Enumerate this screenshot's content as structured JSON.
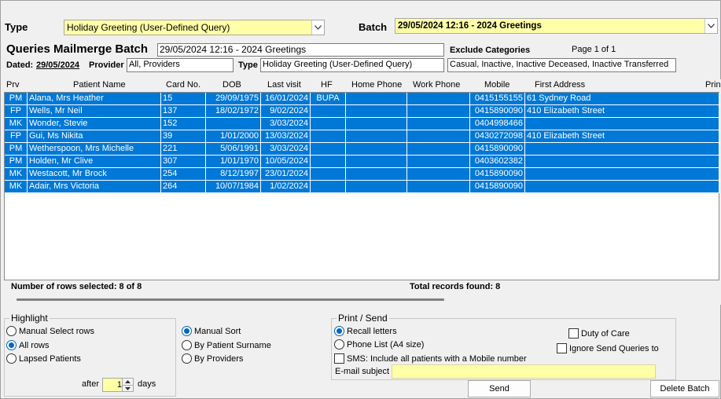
{
  "top": {
    "type_label": "Type",
    "type_value": "Holiday Greeting (User-Defined Query)",
    "batch_label": "Batch",
    "batch_value": "29/05/2024 12:16 - 2024 Greetings"
  },
  "header": {
    "title": "Queries Mailmerge Batch",
    "batch_name": "29/05/2024 12:16 - 2024 Greetings",
    "exclude_label": "Exclude Categories",
    "page_info": "Page 1 of 1",
    "dated_label": "Dated:",
    "dated_value": "29/05/2024",
    "provider_label": "Provider",
    "provider_value": "All,   Providers",
    "type_label": "Type",
    "type_value": "Holiday Greeting (User-Defined Query)",
    "exclude_value": "Casual, Inactive, Inactive Deceased, Inactive Transferred"
  },
  "grid": {
    "columns": [
      "Prv",
      "Patient Name",
      "Card No.",
      "DOB",
      "Last visit",
      "HF",
      "Home Phone",
      "Work Phone",
      "Mobile",
      "First Address",
      "Prin"
    ],
    "rows": [
      [
        "PM",
        "Alana, Mrs Heather",
        "15",
        "29/09/1975",
        "16/01/2024",
        "BUPA",
        "",
        "",
        "0415155155",
        "61 Sydney Road"
      ],
      [
        "FP",
        "Wells, Mr Neil",
        "137",
        "18/02/1972",
        "9/02/2024",
        "",
        "",
        "",
        "0415890090",
        "410 Elizabeth Street"
      ],
      [
        "MK",
        "Wonder,  Stevie",
        "152",
        "",
        "3/03/2024",
        "",
        "",
        "",
        "0404998466",
        ""
      ],
      [
        "FP",
        "Gui, Ms Nikita",
        "39",
        "1/01/2000",
        "13/03/2024",
        "",
        "",
        "",
        "0430272098",
        "410 Elizabeth Street"
      ],
      [
        "PM",
        "Wetherspoon, Mrs Michelle",
        "221",
        "5/06/1991",
        "3/03/2024",
        "",
        "",
        "",
        "0415890090",
        ""
      ],
      [
        "PM",
        "Holden, Mr Clive",
        "307",
        "1/01/1970",
        "10/05/2024",
        "",
        "",
        "",
        "0403602382",
        ""
      ],
      [
        "MK",
        "Westacott, Mr Brock",
        "254",
        "8/12/1997",
        "23/01/2024",
        "",
        "",
        "",
        "0415890090",
        ""
      ],
      [
        "MK",
        "Adair, Mrs Victoria",
        "264",
        "10/07/1984",
        "1/02/2024",
        "",
        "",
        "",
        "0415890090",
        ""
      ]
    ],
    "rows_selected": "Number of rows selected: 8 of 8",
    "total_records": "Total records found: 8"
  },
  "highlight": {
    "title": "Highlight",
    "options": [
      "Manual Select rows",
      "All rows",
      "Lapsed Patients"
    ],
    "selected": "All rows",
    "after_label": "after",
    "after_value": "1",
    "days_label": "days"
  },
  "sort": {
    "options": [
      "Manual Sort",
      "By Patient Surname",
      "By Providers"
    ],
    "selected": "Manual Sort"
  },
  "print_send": {
    "title": "Print / Send",
    "recall": "Recall letters",
    "phone_list": "Phone List (A4 size)",
    "sms": "SMS: Include all patients with a Mobile number",
    "email_label": "E-mail subject",
    "email_value": "",
    "duty_of_care": "Duty of Care",
    "ignore_send": "Ignore Send Queries to",
    "send_button": "Send"
  },
  "delete_button": "Delete Batch",
  "colors": {
    "row_selected": "#0078d7",
    "field_yellow": "#ffffa8",
    "radio_on": "#0067c0"
  }
}
